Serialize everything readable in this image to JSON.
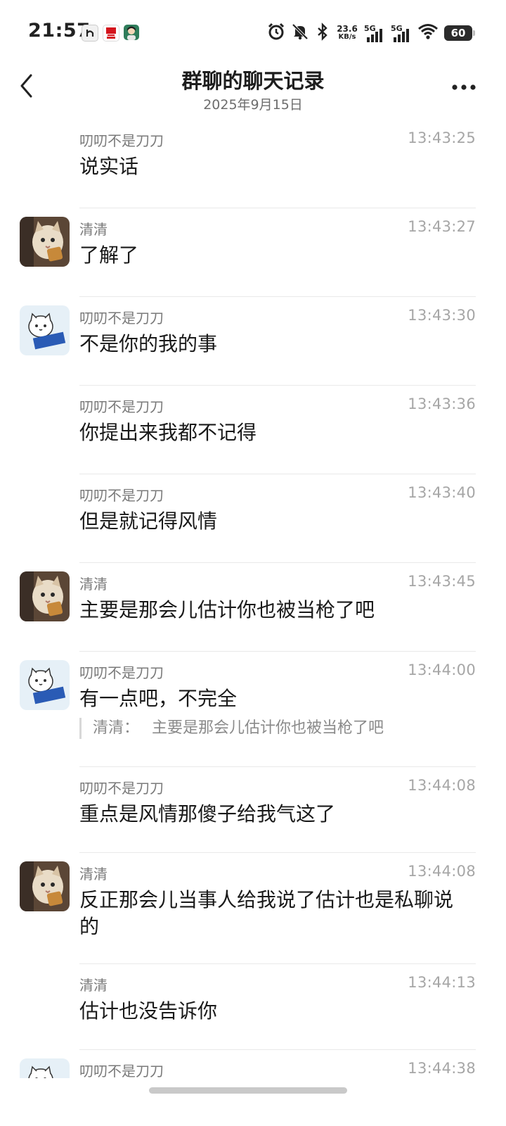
{
  "status_bar": {
    "time": "21:57",
    "net_speed_value": "23.6",
    "net_speed_unit": "KB/s",
    "signal1_label": "5G",
    "signal2_label": "5G",
    "battery": "60",
    "icons": [
      "app-icon-1",
      "kfc-icon",
      "app-icon-3",
      "alarm-icon",
      "mute-icon",
      "bluetooth-icon",
      "signal-icon",
      "signal-icon",
      "wifi-icon",
      "battery-icon"
    ]
  },
  "header": {
    "title": "群聊的聊天记录",
    "date": "2025年9月15日"
  },
  "messages": [
    {
      "sender": "叨叨不是刀刀",
      "time": "13:43:25",
      "text": "说实话",
      "avatar": "none"
    },
    {
      "sender": "清清",
      "time": "13:43:27",
      "text": "了解了",
      "avatar": "cat-photo"
    },
    {
      "sender": "叨叨不是刀刀",
      "time": "13:43:30",
      "text": "不是你的我的事",
      "avatar": "cartoon-cat"
    },
    {
      "sender": "叨叨不是刀刀",
      "time": "13:43:36",
      "text": "你提出来我都不记得",
      "avatar": "none"
    },
    {
      "sender": "叨叨不是刀刀",
      "time": "13:43:40",
      "text": "但是就记得风情",
      "avatar": "none"
    },
    {
      "sender": "清清",
      "time": "13:43:45",
      "text": "主要是那会儿估计你也被当枪了吧",
      "avatar": "cat-photo"
    },
    {
      "sender": "叨叨不是刀刀",
      "time": "13:44:00",
      "text": "有一点吧，不完全",
      "avatar": "cartoon-cat",
      "quote": {
        "sender": "清清：",
        "text": "主要是那会儿估计你也被当枪了吧"
      }
    },
    {
      "sender": "叨叨不是刀刀",
      "time": "13:44:08",
      "text": "重点是风情那傻子给我气这了",
      "avatar": "none"
    },
    {
      "sender": "清清",
      "time": "13:44:08",
      "text": "反正那会儿当事人给我说了估计也是私聊说的",
      "avatar": "cat-photo"
    },
    {
      "sender": "清清",
      "time": "13:44:13",
      "text": "估计也没告诉你",
      "avatar": "none"
    },
    {
      "sender": "叨叨不是刀刀",
      "time": "13:44:38",
      "text": "",
      "avatar": "cartoon-cat"
    }
  ],
  "colors": {
    "text_primary": "#1a1a1a",
    "text_secondary": "#7a7a7a",
    "time_color": "#a6a6a6",
    "separator": "#e9e9e9"
  }
}
